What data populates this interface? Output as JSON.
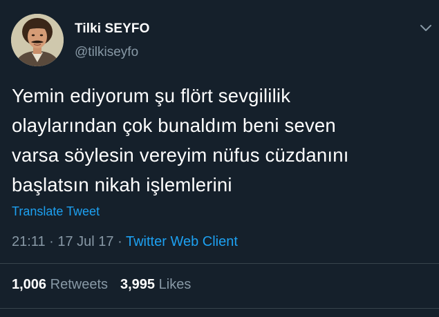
{
  "user": {
    "display_name": "Tilki SEYFO",
    "handle": "@tilkiseyfo"
  },
  "tweet": {
    "lines": [
      "Yemin ediyorum şu flört sevgililik",
      "olaylarından çok bunaldım beni seven",
      "varsa söylesin vereyim nüfus cüzdanını",
      "başlatsın nikah işlemlerini"
    ],
    "translate_label": "Translate Tweet",
    "time": "21:11",
    "date": "17 Jul 17",
    "separator": "·",
    "client": "Twitter Web Client"
  },
  "stats": {
    "retweets_count": "1,006",
    "retweets_label": "Retweets",
    "likes_count": "3,995",
    "likes_label": "Likes"
  },
  "icons": {
    "caret": "chevron-down-icon"
  },
  "colors": {
    "background": "#15202b",
    "text": "#ffffff",
    "secondary": "#8899a6",
    "link": "#1da1f2",
    "divider": "#38444d"
  }
}
